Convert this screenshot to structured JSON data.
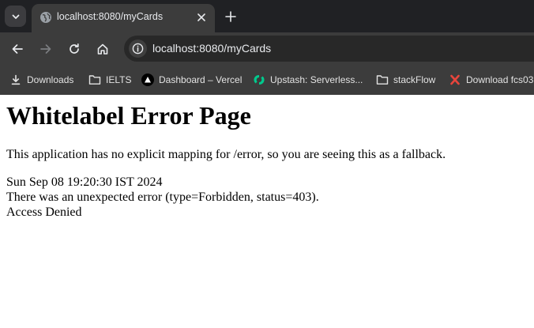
{
  "browser": {
    "tab": {
      "title": "localhost:8080/myCards"
    },
    "address_bar": {
      "url": "localhost:8080/myCards"
    },
    "bookmarks": [
      {
        "label": "Downloads",
        "icon": "download-icon"
      },
      {
        "label": "IELTS",
        "icon": "folder-icon"
      },
      {
        "label": "Dashboard – Vercel",
        "icon": "vercel-icon"
      },
      {
        "label": "Upstash: Serverless...",
        "icon": "upstash-icon"
      },
      {
        "label": "stackFlow",
        "icon": "folder-icon"
      },
      {
        "label": "Download fcs03",
        "icon": "x-icon"
      }
    ]
  },
  "page": {
    "heading": "Whitelabel Error Page",
    "message": "This application has no explicit mapping for /error, so you are seeing this as a fallback.",
    "timestamp": "Sun Sep 08 19:20:30 IST 2024",
    "error_detail": "There was an unexpected error (type=Forbidden, status=403).",
    "error_message": "Access Denied"
  },
  "colors": {
    "chrome_dark": "#202124",
    "toolbar": "#3c3c3c",
    "upstash_green": "#00c98d",
    "x_icon_red": "#e8453c"
  }
}
